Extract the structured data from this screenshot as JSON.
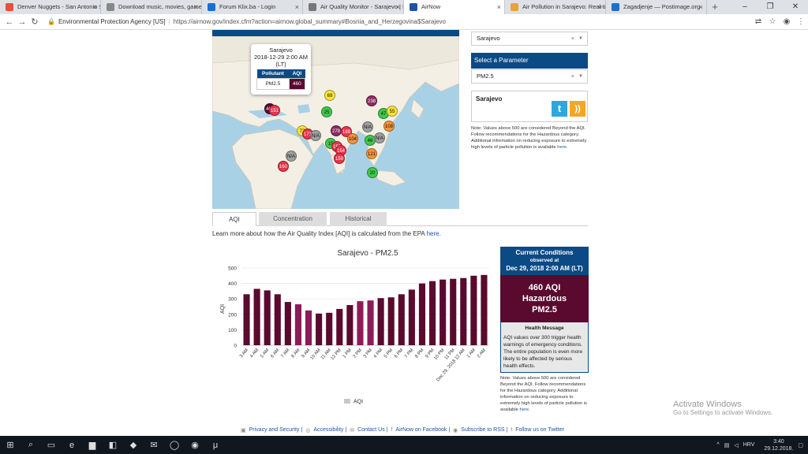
{
  "browser": {
    "tabs": [
      {
        "title": "Denver Nuggets - San Antonio S...",
        "color": "#e8503a",
        "active": false
      },
      {
        "title": "Download music, movies, games...",
        "color": "#888888",
        "active": false
      },
      {
        "title": "Forum Klix.ba - Login",
        "color": "#1a6fd1",
        "active": false
      },
      {
        "title": "Air Quality Monitor - Sarajevo | L...",
        "color": "#777777",
        "active": false
      },
      {
        "title": "AirNow",
        "color": "#1a55a5",
        "active": true
      },
      {
        "title": "Air Pollution in Sarajevo: Real-tim...",
        "color": "#e8a33a",
        "active": false
      },
      {
        "title": "Zagadjenje — Postimage.org",
        "color": "#1a6fd1",
        "active": false
      }
    ],
    "new_tab": "+",
    "window_controls": [
      "–",
      "❐",
      "✕"
    ],
    "site_name": "Environmental Protection Agency [US]",
    "url": "https://airnow.gov/index.cfm?action=airnow.global_summary#Bosnia_and_Herzegovina$Sarajevo"
  },
  "map": {
    "popup": {
      "city": "Sarajevo",
      "datetime": "2018-12-29 2:00 AM (LT)",
      "col_pollutant": "Pollutant",
      "col_aqi": "AQI",
      "pollutant": "PM2.5",
      "aqi": "460"
    },
    "markers": [
      {
        "label": "460",
        "color": "#5a0a2e"
      },
      {
        "label": "151",
        "color": "#e8334a"
      },
      {
        "label": "69",
        "color": "#f5e43a"
      },
      {
        "label": "238",
        "color": "#8e2a62"
      },
      {
        "label": "25",
        "color": "#3ec84a"
      },
      {
        "label": "47",
        "color": "#3ec84a"
      },
      {
        "label": "55",
        "color": "#f5e43a"
      },
      {
        "label": "72",
        "color": "#f5e43a"
      },
      {
        "label": "171",
        "color": "#e8334a"
      },
      {
        "label": "N/A",
        "color": "#a0a0a0"
      },
      {
        "label": "278",
        "color": "#8e2a62"
      },
      {
        "label": "189",
        "color": "#e8334a"
      },
      {
        "label": "N/A",
        "color": "#a0a0a0"
      },
      {
        "label": "108",
        "color": "#f5943a"
      },
      {
        "label": "15",
        "color": "#3ec84a"
      },
      {
        "label": "104",
        "color": "#f5943a"
      },
      {
        "label": "46",
        "color": "#3ec84a"
      },
      {
        "label": "N/A",
        "color": "#a0a0a0"
      },
      {
        "label": "153",
        "color": "#e8334a"
      },
      {
        "label": "154",
        "color": "#e8334a"
      },
      {
        "label": "159",
        "color": "#e8334a"
      },
      {
        "label": "121",
        "color": "#f5943a"
      },
      {
        "label": "N/A",
        "color": "#a0a0a0"
      },
      {
        "label": "160",
        "color": "#e8334a"
      },
      {
        "label": "20",
        "color": "#3ec84a"
      }
    ]
  },
  "right_panel": {
    "city_select": "Sarajevo",
    "param_header": "Select a Parameter",
    "param_select": "PM2.5",
    "location_title": "Sarajevo",
    "twitter_glyph": "t",
    "rss_glyph": "))",
    "note_text": "Note: Values above 500 are considered Beyond the AQI. Follow recommendations for the Hazardous category. Additional information on reducing exposure to extremely high levels of particle pollution is available",
    "note_link": "here."
  },
  "tabs": {
    "aqi": "AQI",
    "concentration": "Concentration",
    "historical": "Historical"
  },
  "learn": {
    "text": "Learn more about how the Air Quality Index [AQI] is calculated from the EPA",
    "link": "here."
  },
  "chart_data": {
    "type": "bar",
    "title": "Sarajevo - PM2.5",
    "ylabel": "AQI",
    "xlabel": "",
    "ylim": [
      0,
      500
    ],
    "yticks": [
      0,
      100,
      200,
      300,
      400,
      500
    ],
    "legend": "AQI",
    "legend_position": "bottom",
    "categories": [
      "3 AM",
      "4 AM",
      "5 AM",
      "6 AM",
      "7 AM",
      "8 AM",
      "9 AM",
      "10 AM",
      "11 AM",
      "12 PM",
      "1 PM",
      "2 PM",
      "3 PM",
      "4 PM",
      "5 PM",
      "6 PM",
      "7 PM",
      "8 PM",
      "9 PM",
      "10 PM",
      "11 PM",
      "Dec 29, 2018 12 AM",
      "1 AM",
      "2 AM"
    ],
    "values": [
      330,
      365,
      355,
      330,
      280,
      265,
      225,
      205,
      210,
      235,
      260,
      285,
      290,
      305,
      310,
      330,
      360,
      400,
      415,
      425,
      430,
      435,
      450,
      455
    ],
    "colors": [
      "#5a0a2e",
      "#5a0a2e",
      "#5a0a2e",
      "#5a0a2e",
      "#5a0a2e",
      "#8e1a5a",
      "#8e1a5a",
      "#5a0a2e",
      "#5a0a2e",
      "#5a0a2e",
      "#5a0a2e",
      "#8e1a5a",
      "#8e1a5a",
      "#5a0a2e",
      "#5a0a2e",
      "#5a0a2e",
      "#5a0a2e",
      "#5a0a2e",
      "#5a0a2e",
      "#5a0a2e",
      "#5a0a2e",
      "#5a0a2e",
      "#5a0a2e",
      "#5a0a2e"
    ]
  },
  "current": {
    "title": "Current Conditions",
    "observed": "observed at",
    "time": "Dec 29, 2018 2:00 AM (LT)",
    "aqi_line": "460 AQI",
    "category": "Hazardous",
    "param": "PM2.5",
    "hm_title": "Health Message",
    "hm_text": "AQI values over 300 trigger health warnings of emergency conditions. The entire population is even more likely to be affected by serious health effects.",
    "note_text": "Note: Values above 500 are considered Beyond the AQI. Follow recommendations for the Hazardous category. Additional information on reducing exposure to extremely high levels of particle pollution is available",
    "note_link": "here."
  },
  "footer": {
    "privacy": "Privacy and Security |",
    "accessibility": "Accessibility |",
    "contact": "Contact Us |",
    "facebook": "AirNow on Facebook |",
    "rss": "Subscribe to RSS |",
    "twitter": "Follow us on Twitter"
  },
  "activation": {
    "title": "Activate Windows",
    "sub": "Go to Settings to activate Windows."
  },
  "taskbar": {
    "lang": "HRV",
    "time": "3:40",
    "date": "29.12.2018."
  }
}
